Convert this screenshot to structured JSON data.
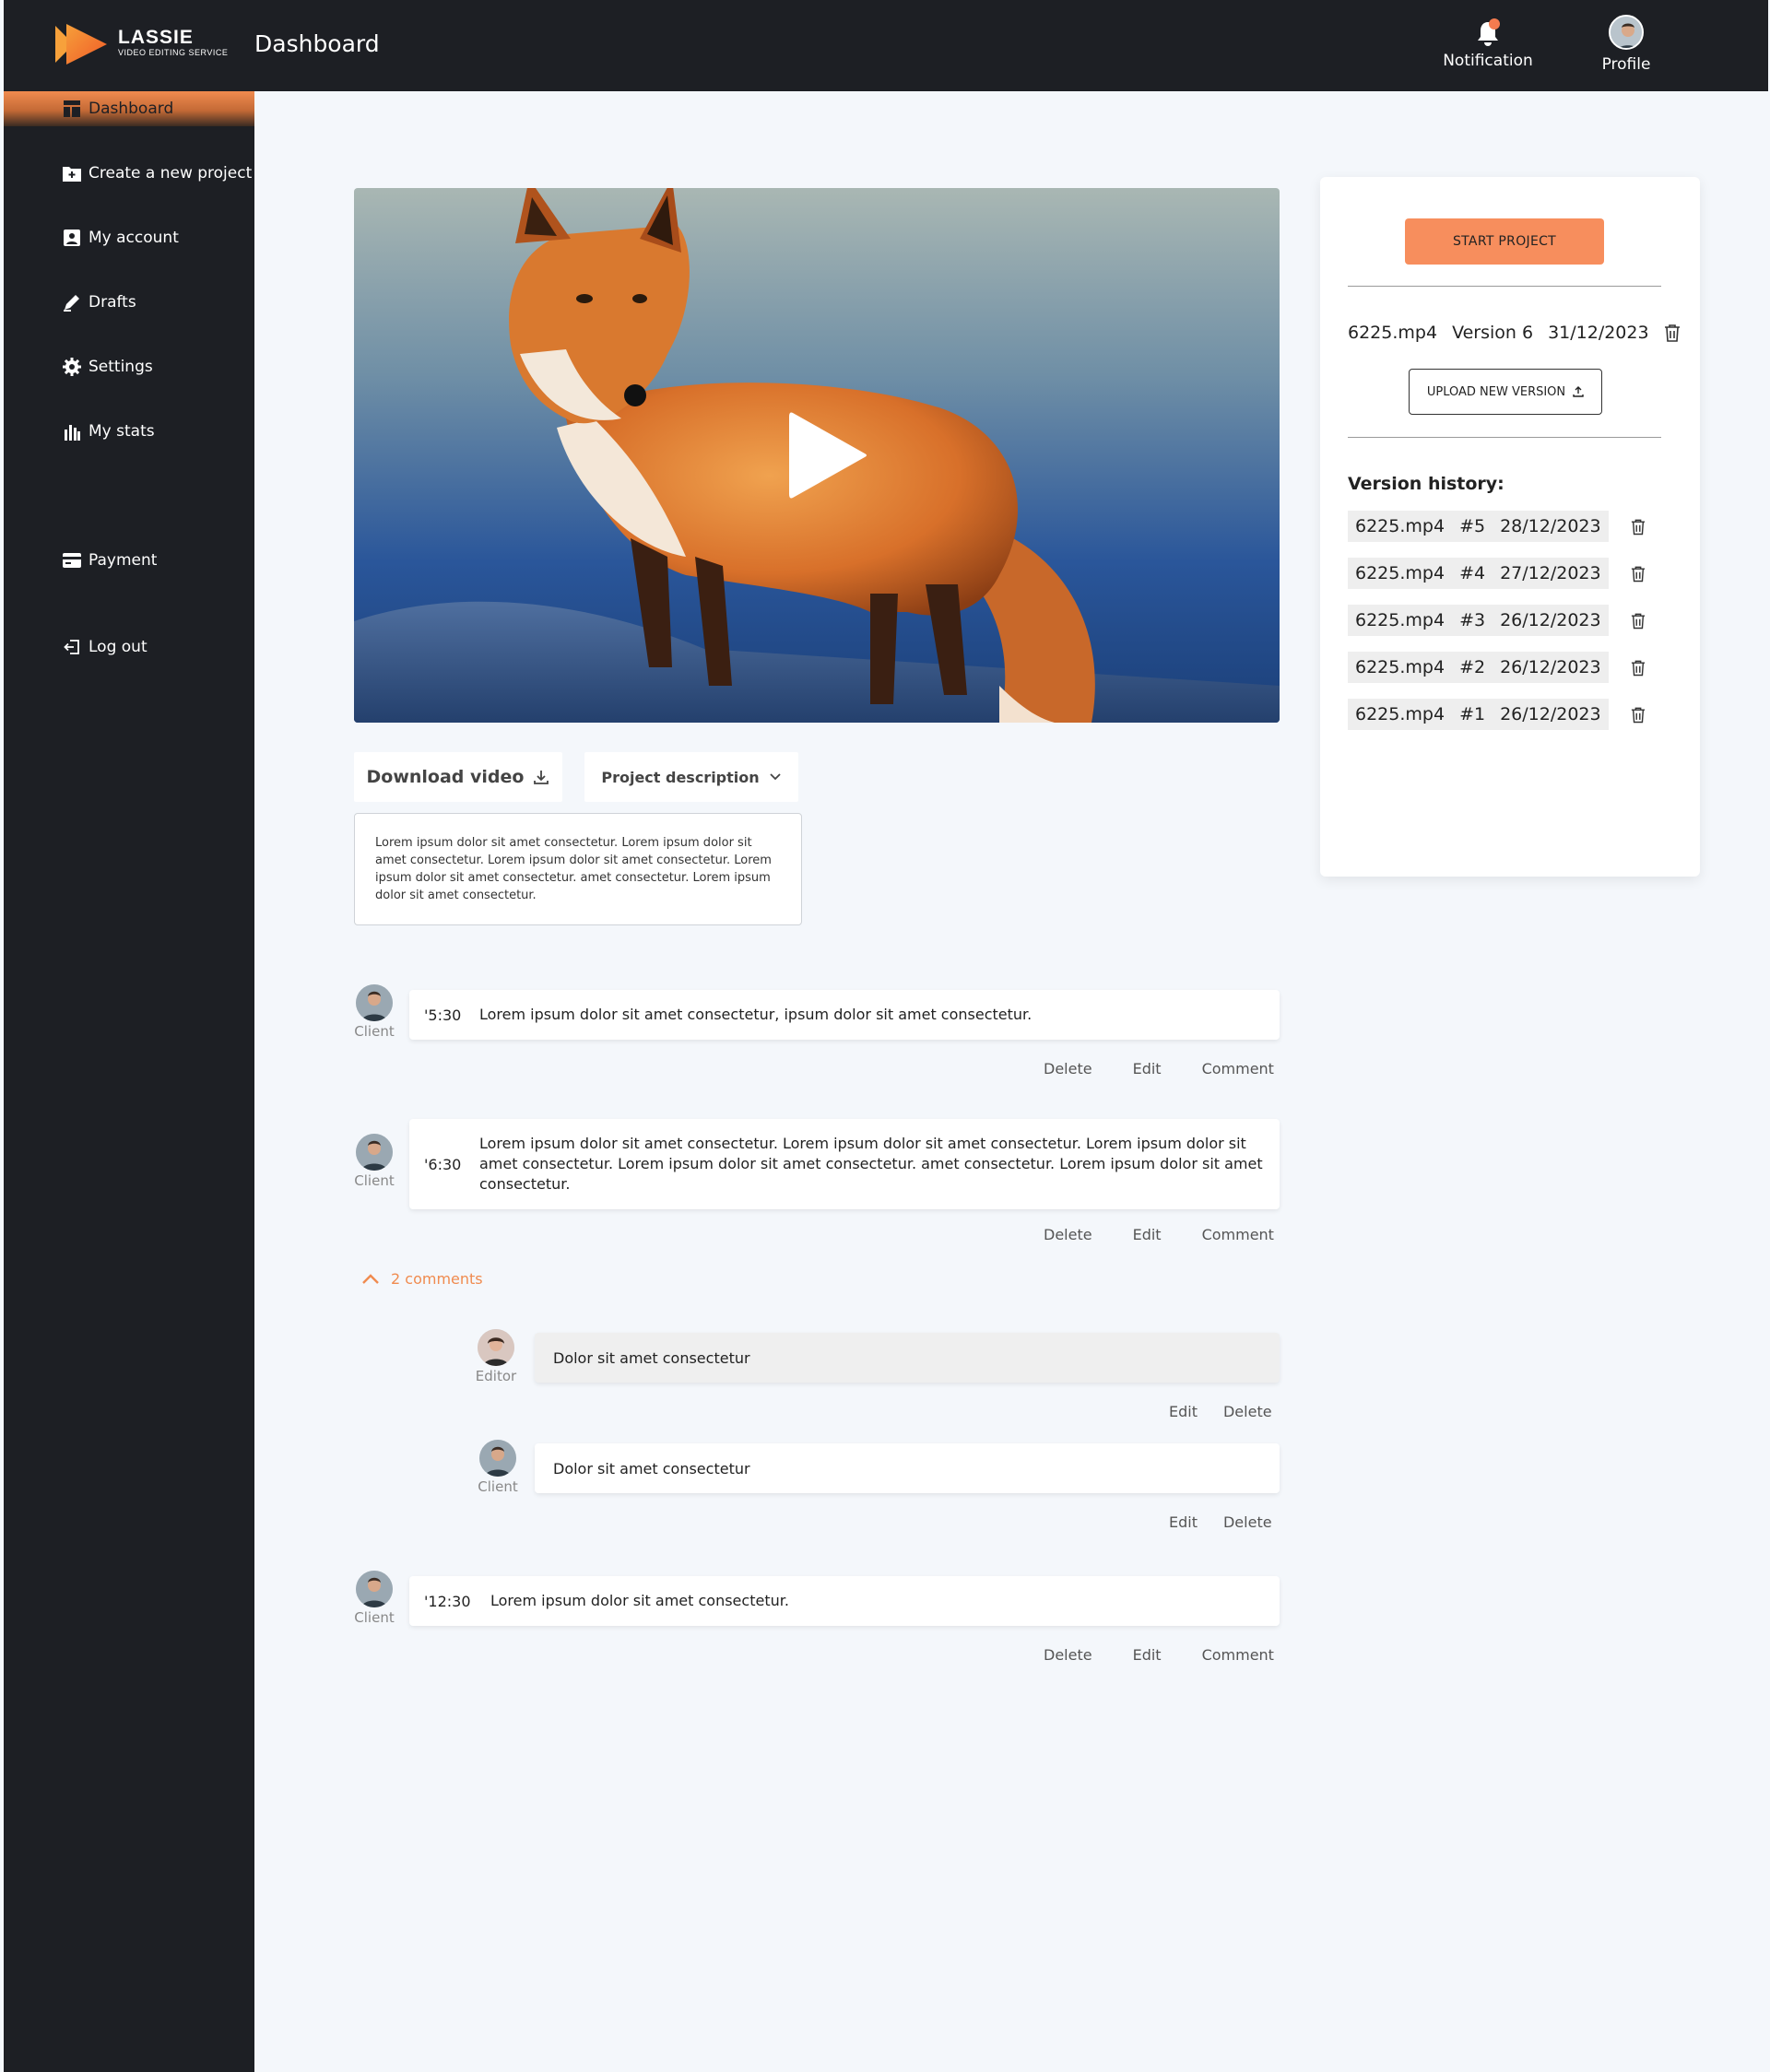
{
  "header": {
    "logo_title": "LASSIE",
    "logo_subtitle": "VIDEO EDITING SERVICE",
    "page_title": "Dashboard",
    "notification_label": "Notification",
    "profile_label": "Profile",
    "notification_badge_color": "#f47b4f"
  },
  "sidebar": {
    "items": [
      {
        "label": "Dashboard",
        "icon": "dashboard-icon",
        "active": true
      },
      {
        "label": "Create a new project",
        "icon": "folder-plus-icon"
      },
      {
        "label": "My account",
        "icon": "account-icon"
      },
      {
        "label": "Drafts",
        "icon": "pencil-icon"
      },
      {
        "label": "Settings",
        "icon": "gear-icon"
      },
      {
        "label": "My stats",
        "icon": "stats-icon"
      },
      {
        "label": "Payment",
        "icon": "card-icon"
      },
      {
        "label": "Log out",
        "icon": "logout-icon"
      }
    ]
  },
  "video": {
    "subject": "fox-video-thumbnail",
    "play_icon": "play-icon"
  },
  "main": {
    "download_label": "Download video",
    "description_label": "Project description",
    "description_text": "Lorem ipsum dolor sit amet consectetur. Lorem ipsum dolor sit amet consectetur.  Lorem ipsum dolor sit amet consectetur. Lorem ipsum dolor sit amet  consectetur.   amet consectetur. Lorem ipsum dolor sit amet  consectetur."
  },
  "comments": [
    {
      "author": "Client",
      "time": "'5:30",
      "text": "Lorem ipsum dolor sit amet consectetur, ipsum dolor sit amet consectetur.",
      "actions": [
        "Delete",
        "Edit",
        "Comment"
      ]
    },
    {
      "author": "Client",
      "time": "'6:30",
      "text": "Lorem ipsum dolor sit amet consectetur. Lorem ipsum dolor sit amet consectetur.  Lorem ipsum dolor sit amet consectetur. Lorem ipsum dolor sit amet  consectetur.   amet consectetur. Lorem ipsum dolor sit amet consectetur.",
      "actions": [
        "Delete",
        "Edit",
        "Comment"
      ]
    },
    {
      "author": "Client",
      "time": "'12:30",
      "text": "Lorem ipsum dolor sit amet consectetur.",
      "actions": [
        "Delete",
        "Edit",
        "Comment"
      ]
    }
  ],
  "replies_toggle": "2 comments",
  "replies": [
    {
      "author": "Editor",
      "text": "Dolor sit amet consectetur",
      "actions": [
        "Edit",
        "Delete"
      ]
    },
    {
      "author": "Client",
      "text": "Dolor sit amet consectetur",
      "actions": [
        "Edit",
        "Delete"
      ]
    }
  ],
  "panel": {
    "start_label": "START PROJECT",
    "current_file": "6225.mp4",
    "current_version": "Version  6",
    "current_date": "31/12/2023",
    "upload_label": "UPLOAD NEW VERSION",
    "history_title": "Version history:",
    "history": [
      {
        "file": "6225.mp4",
        "num": "#5",
        "date": "28/12/2023"
      },
      {
        "file": "6225.mp4",
        "num": "#4",
        "date": "27/12/2023"
      },
      {
        "file": "6225.mp4",
        "num": "#3",
        "date": "26/12/2023"
      },
      {
        "file": "6225.mp4",
        "num": "#2",
        "date": "26/12/2023"
      },
      {
        "file": "6225.mp4",
        "num": "#1",
        "date": "26/12/2023"
      }
    ],
    "accent_color": "#f78e5d"
  }
}
